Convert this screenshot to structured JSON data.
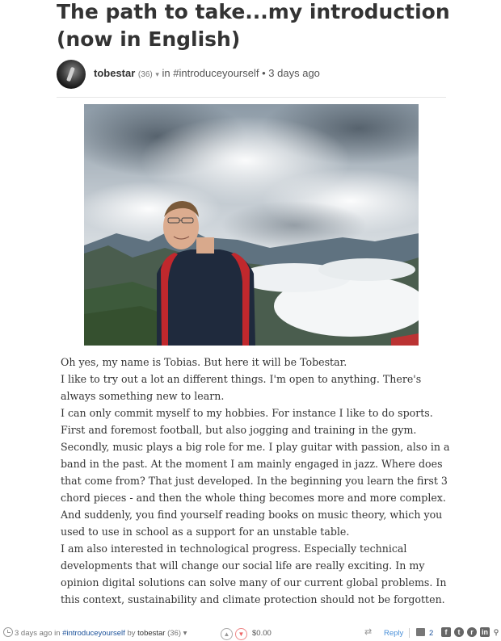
{
  "post": {
    "title": "The path to take...my introduction (now in English)",
    "author": "tobestar",
    "reputation": "(36)",
    "in_label": "in",
    "category": "#introduceyourself",
    "bullet": "•",
    "time_ago": "3 days ago"
  },
  "body": {
    "paragraphs": [
      "Oh yes, my name is Tobias. But here it will be Tobestar.",
      "I like to try out a lot an different things. I'm open to anything. There's always something new to learn.",
      "I can only commit myself to my hobbies. For instance I like to do sports. First and foremost football, but also jogging and training in the gym.",
      "Secondly, music plays a big role for me. I play guitar with passion, also in a band in the past. At the moment I am mainly engaged in jazz. Where does that come from? That just developed. In the beginning you learn the first 3 chord pieces - and then the whole thing becomes more and more complex. And suddenly, you find yourself reading books on music theory, which you used to use in school as a support for an unstable table.",
      "I am also interested in technological progress. Especially technical developments that will change our social life are really exciting. In my opinion digital solutions can solve many of our current global problems. In this context, sustainability and climate protection should not be forgotten."
    ]
  },
  "footer": {
    "time_ago": "3 days ago",
    "in_label": "in",
    "category": "#introduceyourself",
    "by_label": "by",
    "author": "tobestar",
    "reputation": "(36)",
    "payout": "$0.00",
    "reply_label": "Reply",
    "comment_count": "2"
  },
  "icons": {
    "avatar": "avatar-image",
    "clock": "clock-icon",
    "upvote": "upvote-icon",
    "downvote": "downvote-icon",
    "resteem": "resteem-icon",
    "comments": "comment-icon",
    "facebook": "facebook-icon",
    "twitter": "twitter-icon",
    "reddit": "reddit-icon",
    "linkedin": "linkedin-icon",
    "link": "link-icon"
  },
  "colors": {
    "link": "#1a5099",
    "reply": "#4a90d9",
    "downvote": "#e66666"
  }
}
